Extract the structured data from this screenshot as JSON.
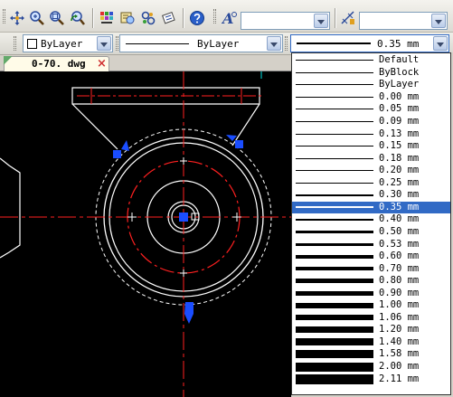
{
  "toolbar_top": {
    "icons": [
      "pan-realtime-icon",
      "zoom-realtime-icon",
      "zoom-window-icon",
      "zoom-previous-icon",
      "properties-icon",
      "design-center-icon",
      "tool-palettes-icon",
      "markup-icon",
      "help-icon",
      "text-style-icon",
      "dimension-style-icon"
    ],
    "text_style_value": "",
    "dim_style_value": ""
  },
  "toolbar_props": {
    "layer_color_value": "ByLayer",
    "linetype_value": "ByLayer",
    "lineweight_value": "0.35 mm"
  },
  "tab": {
    "label": "0-70. dwg"
  },
  "lineweight_list": {
    "selected_index": 12,
    "items": [
      {
        "label": "Default",
        "weight": 0.5
      },
      {
        "label": "ByBlock",
        "weight": 0.5
      },
      {
        "label": "ByLayer",
        "weight": 0.5
      },
      {
        "label": "0.00 mm",
        "weight": 0.5
      },
      {
        "label": "0.05 mm",
        "weight": 0.6
      },
      {
        "label": "0.09 mm",
        "weight": 0.7
      },
      {
        "label": "0.13 mm",
        "weight": 0.8
      },
      {
        "label": "0.15 mm",
        "weight": 0.9
      },
      {
        "label": "0.18 mm",
        "weight": 1.0
      },
      {
        "label": "0.20 mm",
        "weight": 1.1
      },
      {
        "label": "0.25 mm",
        "weight": 1.2
      },
      {
        "label": "0.30 mm",
        "weight": 1.5
      },
      {
        "label": "0.35 mm",
        "weight": 2
      },
      {
        "label": "0.40 mm",
        "weight": 2
      },
      {
        "label": "0.50 mm",
        "weight": 3
      },
      {
        "label": "0.53 mm",
        "weight": 3
      },
      {
        "label": "0.60 mm",
        "weight": 4
      },
      {
        "label": "0.70 mm",
        "weight": 4
      },
      {
        "label": "0.80 mm",
        "weight": 5
      },
      {
        "label": "0.90 mm",
        "weight": 5
      },
      {
        "label": "1.00 mm",
        "weight": 6
      },
      {
        "label": "1.06 mm",
        "weight": 6
      },
      {
        "label": "1.20 mm",
        "weight": 7
      },
      {
        "label": "1.40 mm",
        "weight": 8
      },
      {
        "label": "1.58 mm",
        "weight": 9
      },
      {
        "label": "2.00 mm",
        "weight": 10
      },
      {
        "label": "2.11 mm",
        "weight": 11
      }
    ]
  },
  "colors": {
    "selection": "#316ac5",
    "drawing_red": "#ff2020",
    "grip_blue": "#1a4dff"
  }
}
